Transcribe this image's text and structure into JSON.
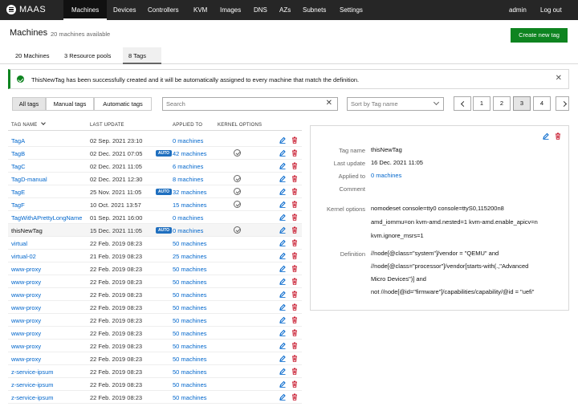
{
  "topbar": {
    "brand": "MAAS",
    "nav": [
      "Machines",
      "Devices",
      "Controllers",
      "KVM",
      "Images",
      "DNS",
      "AZs",
      "Subnets",
      "Settings"
    ],
    "user": "admin",
    "logout": "Log out"
  },
  "header": {
    "title": "Machines",
    "count": "20 machines available",
    "create_button": "Create new tag"
  },
  "tabs": [
    "20 Machines",
    "3 Resource pools",
    "8 Tags"
  ],
  "notification": {
    "message": "ThisNewTag has been successfully created and it will be automatically assigned to every machine that match the definition."
  },
  "filters": [
    "All tags",
    "Manual tags",
    "Automatic tags"
  ],
  "search": {
    "placeholder": "Search"
  },
  "sort": {
    "placeholder": "Sort by Tag name"
  },
  "pagination": {
    "pages": [
      "1",
      "2",
      "3",
      "4"
    ],
    "current": "3"
  },
  "table": {
    "headers": {
      "name": "TAG NAME",
      "updated": "LAST UPDATE",
      "applied": "APPLIED TO",
      "kernel": "KERNEL OPTIONS"
    },
    "rows": [
      {
        "name": "TagA",
        "updated": "02 Sep. 2021 23:10",
        "applied": "0 machines",
        "auto": "",
        "kernel": false
      },
      {
        "name": "TagB",
        "updated": "02 Dec. 2021 07:05",
        "applied": "42 machines",
        "auto": "AUTO",
        "kernel": true
      },
      {
        "name": "TagC",
        "updated": "02 Dec. 2021 11:05",
        "applied": "6 machines",
        "auto": "",
        "kernel": false
      },
      {
        "name": "TagD-manual",
        "updated": "02 Dec. 2021 12:30",
        "applied": "8 machines",
        "auto": "",
        "kernel": true
      },
      {
        "name": "TagE",
        "updated": "25 Nov. 2021 11:05",
        "applied": "32 machines",
        "auto": "AUTO",
        "kernel": true
      },
      {
        "name": "TagF",
        "updated": "10 Oct. 2021 13:57",
        "applied": "15 machines",
        "auto": "",
        "kernel": true
      },
      {
        "name": "TagWithAPrettyLongName",
        "updated": "01 Sep. 2021 16:00",
        "applied": "0 machines",
        "auto": "",
        "kernel": false
      },
      {
        "name": "thisNewTag",
        "updated": "15 Dec. 2021 11:05",
        "applied": "0 machines",
        "auto": "AUTO",
        "kernel": true
      },
      {
        "name": "virtual",
        "updated": "22 Feb. 2019 08:23",
        "applied": "50 machines",
        "auto": "",
        "kernel": false
      },
      {
        "name": "virtual-02",
        "updated": "21 Feb. 2019 08:23",
        "applied": "25 machines",
        "auto": "",
        "kernel": false
      },
      {
        "name": "www-proxy",
        "updated": "22 Feb. 2019 08:23",
        "applied": "50 machines",
        "auto": "",
        "kernel": false
      },
      {
        "name": "www-proxy",
        "updated": "22 Feb. 2019 08:23",
        "applied": "50 machines",
        "auto": "",
        "kernel": false
      },
      {
        "name": "www-proxy",
        "updated": "22 Feb. 2019 08:23",
        "applied": "50 machines",
        "auto": "",
        "kernel": false
      },
      {
        "name": "www-proxy",
        "updated": "22 Feb. 2019 08:23",
        "applied": "50 machines",
        "auto": "",
        "kernel": false
      },
      {
        "name": "www-proxy",
        "updated": "22 Feb. 2019 08:23",
        "applied": "50 machines",
        "auto": "",
        "kernel": false
      },
      {
        "name": "www-proxy",
        "updated": "22 Feb. 2019 08:23",
        "applied": "50 machines",
        "auto": "",
        "kernel": false
      },
      {
        "name": "www-proxy",
        "updated": "22 Feb. 2019 08:23",
        "applied": "50 machines",
        "auto": "",
        "kernel": false
      },
      {
        "name": "www-proxy",
        "updated": "22 Feb. 2019 08:23",
        "applied": "50 machines",
        "auto": "",
        "kernel": false
      },
      {
        "name": "z-service-ipsum",
        "updated": "22 Feb. 2019 08:23",
        "applied": "50 machines",
        "auto": "",
        "kernel": false
      },
      {
        "name": "z-service-ipsum",
        "updated": "22 Feb. 2019 08:23",
        "applied": "50 machines",
        "auto": "",
        "kernel": false
      },
      {
        "name": "z-service-ipsum",
        "updated": "22 Feb. 2019 08:23",
        "applied": "50 machines",
        "auto": "",
        "kernel": false
      }
    ]
  },
  "detail": {
    "tag_name_label": "Tag name",
    "tag_name": "thisNewTag",
    "last_update_label": "Last update",
    "last_update": "16 Dec. 2021 11:05",
    "applied_label": "Applied to",
    "applied": "0 machines",
    "comment_label": "Comment",
    "kernel_label": "Kernel options",
    "kernel_lines": [
      "nomodeset console=tty0 console=ttyS0,115200n8",
      "amd_iommu=on kvm-amd.nested=1 kvm-amd.enable_apicv=n",
      "kvm.ignore_msrs=1"
    ],
    "definition_label": "Definition",
    "definition_lines": [
      "//node[@class=\"system\"]/vendor = \"QEMU\" and",
      "//node[@class=\"processor\"]/vendor[starts-with(.,\"Advanced",
      "Micro Devices\")] and",
      "not //node[@id=\"firmware\"]/capabilities/capability/@id = \"uefi\""
    ]
  },
  "colors": {
    "accent": "#0e8420",
    "link": "#0066cc",
    "topbar": "#262626",
    "auto_badge": "#1f6fbf",
    "delete": "#c7162b"
  },
  "icons": {
    "notification": "success-icon",
    "close": "close-icon",
    "edit": "pencil-icon",
    "delete": "trash-icon",
    "kernel": "check-circle-icon"
  }
}
